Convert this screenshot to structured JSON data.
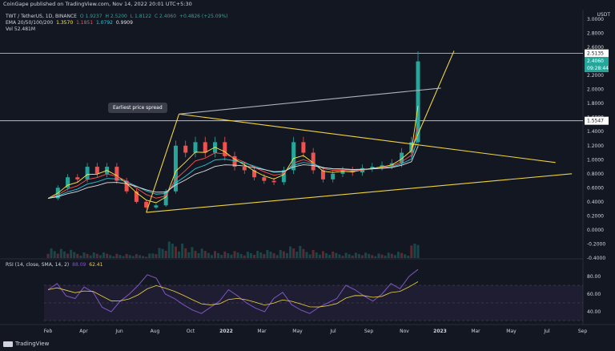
{
  "publish_line": "CoinGape published on TradingView.com, Nov 14, 2022 20:01 UTC+5:30",
  "legend": {
    "symbol": "TWT / TetherUS, 1D, BINANCE",
    "o": "O 1.9237",
    "h": "H 2.5200",
    "l": "L 1.8122",
    "c": "C 2.4060",
    "change": "+0.4826 (+25.09%)",
    "ema_label": "EMA 20/50/100/200",
    "ema_values": [
      "1.3570",
      "1.1851",
      "1.0792",
      "0.9909"
    ],
    "vol": "Vol 52.481M"
  },
  "annotation": "Earliest price spread",
  "rsi_legend": {
    "label": "RSI (14, close, SMA, 14, 2)",
    "v1": "88.09",
    "v2": "62.41"
  },
  "footer": "TradingView",
  "colors": {
    "bg": "#131722",
    "up": "#26a69a",
    "down": "#ef5350",
    "pattern": "#f0d33a",
    "rsi": "#7e57c2"
  },
  "chart_data": [
    {
      "type": "candlestick",
      "currency": "USDT",
      "ylim": [
        -0.4,
        3.0
      ],
      "y_ticks": [
        "3.0000",
        "2.8000",
        "2.6000",
        "2.4000",
        "2.2000",
        "2.0000",
        "1.8000",
        "1.6000",
        "1.4000",
        "1.2000",
        "1.0000",
        "0.8000",
        "0.6000",
        "0.4000",
        "0.2000",
        "0.0000",
        "-0.2000",
        "-0.4000"
      ],
      "price_labels": [
        "2.5135",
        "2.4060",
        "09:28:44",
        "1.5547"
      ],
      "x_ticks": [
        "Feb",
        "Apr",
        "Jun",
        "Aug",
        "Oct",
        "2022",
        "Mar",
        "May",
        "Jul",
        "Sep",
        "Nov",
        "2023",
        "Mar",
        "May",
        "Jul",
        "Sep"
      ],
      "close_path": [
        [
          0,
          0.45
        ],
        [
          3,
          0.6
        ],
        [
          6,
          0.75
        ],
        [
          9,
          0.72
        ],
        [
          12,
          0.9
        ],
        [
          15,
          0.8
        ],
        [
          18,
          0.9
        ],
        [
          21,
          0.7
        ],
        [
          24,
          0.55
        ],
        [
          27,
          0.4
        ],
        [
          30,
          0.32
        ],
        [
          33,
          0.35
        ],
        [
          36,
          0.55
        ],
        [
          39,
          1.2
        ],
        [
          42,
          1.1
        ],
        [
          45,
          1.25
        ],
        [
          48,
          1.1
        ],
        [
          51,
          1.25
        ],
        [
          54,
          1.05
        ],
        [
          57,
          0.9
        ],
        [
          60,
          0.85
        ],
        [
          63,
          0.75
        ],
        [
          66,
          0.7
        ],
        [
          69,
          0.68
        ],
        [
          72,
          0.85
        ],
        [
          75,
          1.25
        ],
        [
          78,
          1.1
        ],
        [
          81,
          0.85
        ],
        [
          84,
          0.72
        ],
        [
          87,
          0.8
        ],
        [
          90,
          0.85
        ],
        [
          93,
          0.82
        ],
        [
          96,
          0.88
        ],
        [
          99,
          0.9
        ],
        [
          102,
          0.92
        ],
        [
          105,
          0.95
        ],
        [
          108,
          1.1
        ],
        [
          111,
          1.25
        ],
        [
          113,
          2.4
        ]
      ],
      "volume_path": [
        [
          0,
          0.35
        ],
        [
          10,
          0.2
        ],
        [
          20,
          0.15
        ],
        [
          30,
          0.1
        ],
        [
          39,
          0.6
        ],
        [
          45,
          0.3
        ],
        [
          55,
          0.2
        ],
        [
          70,
          0.25
        ],
        [
          75,
          0.4
        ],
        [
          85,
          0.2
        ],
        [
          100,
          0.15
        ],
        [
          110,
          0.2
        ],
        [
          113,
          0.9
        ]
      ]
    },
    {
      "type": "line",
      "name": "RSI",
      "ylim": [
        30,
        90
      ],
      "y_ticks": [
        "80.00",
        "60.00",
        "40.00"
      ],
      "values": [
        65,
        72,
        58,
        55,
        68,
        62,
        45,
        40,
        52,
        60,
        70,
        82,
        78,
        60,
        55,
        48,
        42,
        38,
        45,
        52,
        65,
        58,
        50,
        44,
        40,
        55,
        62,
        48,
        42,
        38,
        45,
        50,
        55,
        70,
        65,
        58,
        52,
        60,
        72,
        66,
        80,
        88
      ]
    }
  ]
}
